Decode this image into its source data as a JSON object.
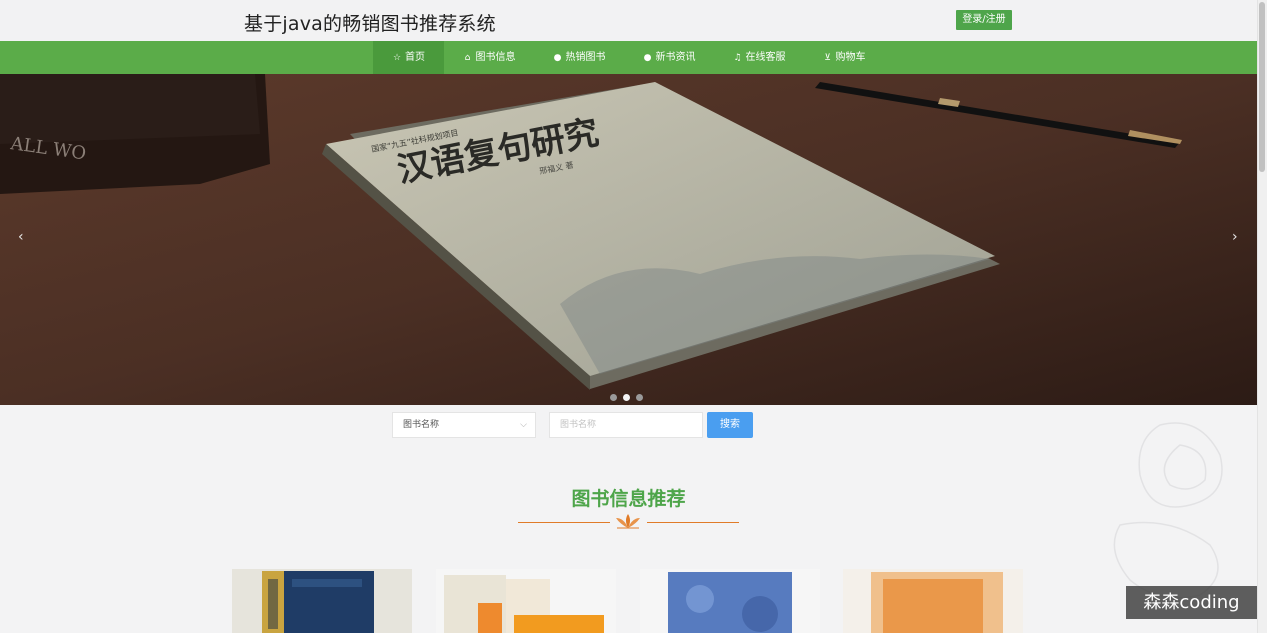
{
  "header": {
    "site_title": "基于java的畅销图书推荐系统",
    "login_label": "登录/注册"
  },
  "nav": {
    "items": [
      {
        "label": "首页",
        "icon": "home-icon",
        "active": true
      },
      {
        "label": "图书信息",
        "icon": "bag-icon"
      },
      {
        "label": "热销图书",
        "icon": "info-circle-icon"
      },
      {
        "label": "新书资讯",
        "icon": "info-circle-icon"
      },
      {
        "label": "在线客服",
        "icon": "headset-icon"
      },
      {
        "label": "购物车",
        "icon": "cart-icon"
      }
    ]
  },
  "banner": {
    "book_title_text": "汉语复句研究",
    "book_tag_text": "国家“九五”社科规划项目",
    "book_author_text": "邢福义 著",
    "prev_arrow": "‹",
    "next_arrow": "›",
    "slide_count": 3,
    "active_slide": 2
  },
  "search": {
    "select_value": "图书名称",
    "input_placeholder": "图书名称",
    "button_label": "搜索"
  },
  "section": {
    "title": "图书信息推荐"
  },
  "watermark": {
    "text": "森森coding"
  },
  "colors": {
    "brand_green": "#5bac49",
    "title_green": "#4ea54a",
    "search_blue": "#4a9ef0",
    "accent_orange": "#e07b28"
  }
}
